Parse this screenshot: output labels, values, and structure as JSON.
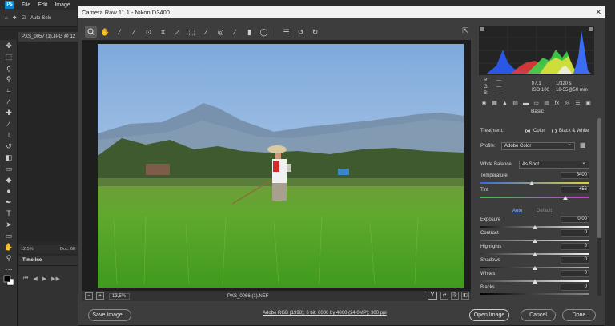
{
  "ps": {
    "menu": [
      "File",
      "Edit",
      "Image"
    ],
    "options_label": "Auto-Sele",
    "doc_tab": "PXS_0057 (1).JPG @ 12",
    "status_zoom": "12,5%",
    "status_doc": "Doc: 68",
    "timeline_label": "Timeline"
  },
  "cr": {
    "title": "Camera Raw 11.1  -  Nikon D3400",
    "filename": "PXS_0066 (1).NEF",
    "zoom": "13,5%",
    "view_mode": "Y",
    "workflow": "Adobe RGB (1998); 8 bit; 6000 by 4000 (24,0MP); 300 ppi",
    "buttons": {
      "save": "Save Image...",
      "open": "Open Image",
      "cancel": "Cancel",
      "done": "Done"
    },
    "hist": {
      "r": "R:",
      "g": "G:",
      "b": "B:",
      "dash": "---",
      "aperture": "f/7,1",
      "shutter": "1/320 s",
      "iso": "ISO 100",
      "lens": "18-55@50 mm"
    },
    "panel_title": "Basic",
    "treatment_label": "Treatment:",
    "treatment_color": "Color",
    "treatment_bw": "Black & White",
    "profile_label": "Profile:",
    "profile_value": "Adobe Color",
    "wb_label": "White Balance:",
    "wb_value": "As Shot",
    "auto": "Auto",
    "default": "Default",
    "sliders": {
      "temperature": {
        "label": "Temperature",
        "value": "5400",
        "pos": 0.47
      },
      "tint": {
        "label": "Tint",
        "value": "+56",
        "pos": 0.78
      },
      "exposure": {
        "label": "Exposure",
        "value": "0,00",
        "pos": 0.5
      },
      "contrast": {
        "label": "Contrast",
        "value": "0",
        "pos": 0.5
      },
      "highlights": {
        "label": "Highlights",
        "value": "0",
        "pos": 0.5
      },
      "shadows": {
        "label": "Shadows",
        "value": "0",
        "pos": 0.5
      },
      "whites": {
        "label": "Whites",
        "value": "0",
        "pos": 0.5
      },
      "blacks": {
        "label": "Blacks",
        "value": "0",
        "pos": 0.5
      }
    }
  }
}
